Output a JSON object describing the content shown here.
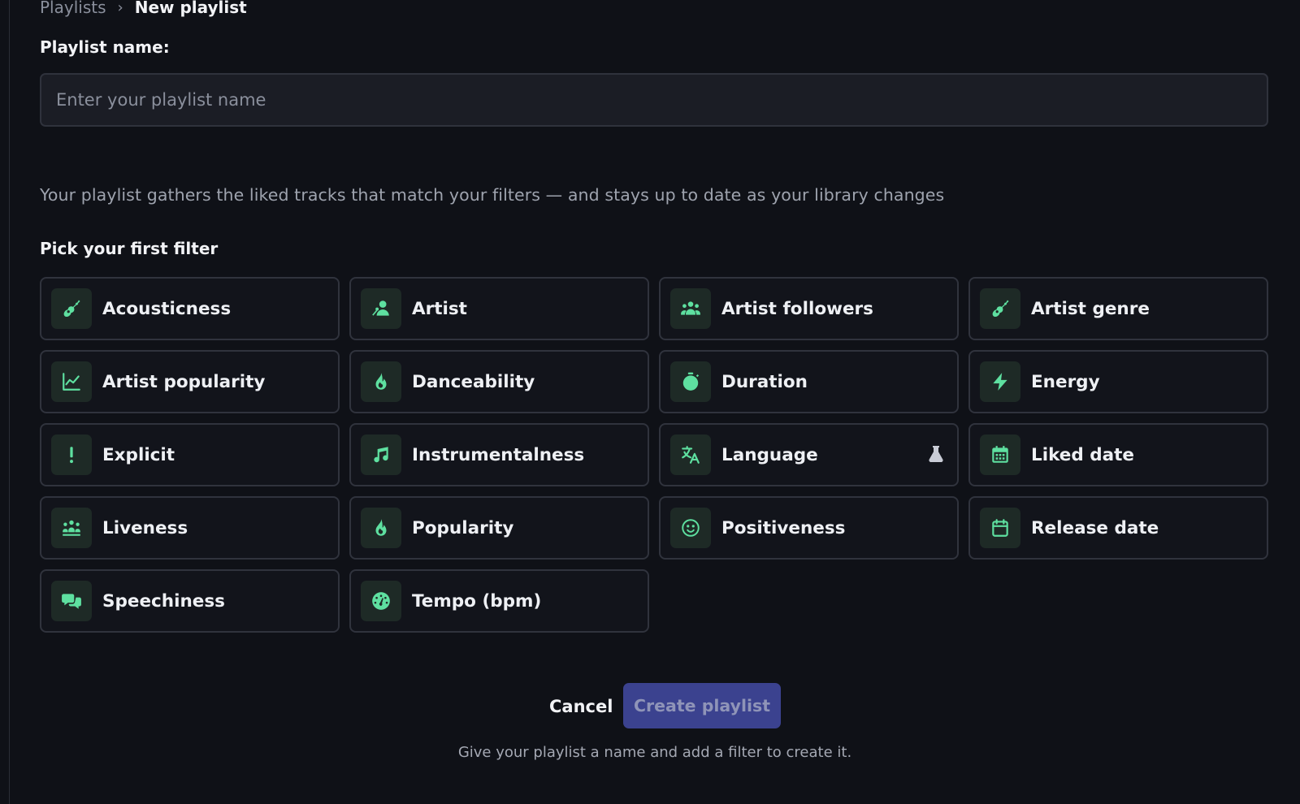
{
  "breadcrumb": {
    "parent": "Playlists",
    "separator": "›",
    "current": "New playlist"
  },
  "name_field": {
    "label": "Playlist name:",
    "placeholder": "Enter your playlist name",
    "value": ""
  },
  "description": "Your playlist gathers the liked tracks that match your filters — and stays up to date as your library changes",
  "filters_heading": "Pick your first filter",
  "filters": [
    {
      "label": "Acousticness",
      "icon": "guitar-icon"
    },
    {
      "label": "Artist",
      "icon": "artist-icon"
    },
    {
      "label": "Artist followers",
      "icon": "users-icon"
    },
    {
      "label": "Artist genre",
      "icon": "guitar-icon"
    },
    {
      "label": "Artist popularity",
      "icon": "chart-line-icon"
    },
    {
      "label": "Danceability",
      "icon": "fire-icon"
    },
    {
      "label": "Duration",
      "icon": "stopwatch-icon"
    },
    {
      "label": "Energy",
      "icon": "bolt-icon"
    },
    {
      "label": "Explicit",
      "icon": "exclamation-icon"
    },
    {
      "label": "Instrumentalness",
      "icon": "music-note-icon"
    },
    {
      "label": "Language",
      "icon": "translate-icon",
      "badge_icon": "flask-icon"
    },
    {
      "label": "Liked date",
      "icon": "calendar-grid-icon"
    },
    {
      "label": "Liveness",
      "icon": "crowd-icon"
    },
    {
      "label": "Popularity",
      "icon": "fire-icon"
    },
    {
      "label": "Positiveness",
      "icon": "smile-icon"
    },
    {
      "label": "Release date",
      "icon": "calendar-icon"
    },
    {
      "label": "Speechiness",
      "icon": "chat-bubbles-icon"
    },
    {
      "label": "Tempo (bpm)",
      "icon": "gauge-icon"
    }
  ],
  "actions": {
    "cancel_label": "Cancel",
    "create_label": "Create playlist",
    "create_disabled": true
  },
  "hint": "Give your playlist a name and add a filter to create it.",
  "colors": {
    "background": "#0f1117",
    "accent_icon": "#5ee0a0",
    "primary_button": "#3b428f"
  }
}
